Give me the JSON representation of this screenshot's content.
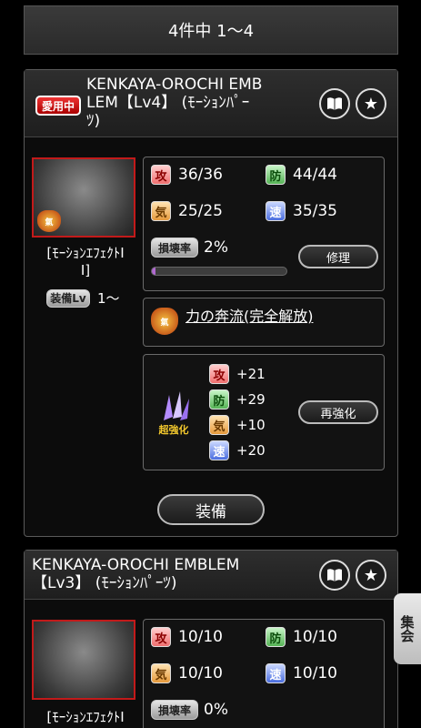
{
  "header": {
    "title": "4件中 1〜4"
  },
  "cards": [
    {
      "in_use_label": "愛用中",
      "title": "KENKAYA-OROCHI EMBLEM【Lv4】 (ﾓｰｼｮﾝﾊﾟｰﾂ)",
      "title_line1": "KENKAYA-OROCHI EMB",
      "title_line2": "LEM【Lv4】 (ﾓｰｼｮﾝﾊﾟｰ",
      "title_line3": "ﾂ)",
      "category": "[ﾓｰｼｮﾝｴﾌｪｸﾄI",
      "category2": "I]",
      "equip_lv_label": "装備Lv",
      "equip_lv_value": "1〜",
      "stats": {
        "atk_label": "攻",
        "atk": "36/36",
        "def_label": "防",
        "def": "44/44",
        "spi_label": "気",
        "spi": "25/25",
        "spd_label": "速",
        "spd": "35/35"
      },
      "damage_label": "損壊率",
      "damage_value": "2%",
      "damage_progress": 0.02,
      "repair_label": "修理",
      "skill_name": "力の奔流(完全解放)",
      "enhance_label": "超強化",
      "bonus": {
        "atk_label": "攻",
        "atk": "+21",
        "def_label": "防",
        "def": "+29",
        "spi_label": "気",
        "spi": "+10",
        "spd_label": "速",
        "spd": "+20"
      },
      "reenhance_label": "再強化",
      "equip_button": "装備"
    },
    {
      "title_line1": "KENKAYA-OROCHI EMBLEM",
      "title_line2": "【Lv3】 (ﾓｰｼｮﾝﾊﾟｰﾂ)",
      "category": "[ﾓｰｼｮﾝｴﾌｪｸﾄI",
      "stats": {
        "atk_label": "攻",
        "atk": "10/10",
        "def_label": "防",
        "def": "10/10",
        "spi_label": "気",
        "spi": "10/10",
        "spd_label": "速",
        "spd": "10/10"
      },
      "damage_label": "損壊率",
      "damage_value": "0%"
    }
  ],
  "side_tab": {
    "label": "集会"
  },
  "icons": {
    "book": "book-icon",
    "star": "star-icon"
  }
}
